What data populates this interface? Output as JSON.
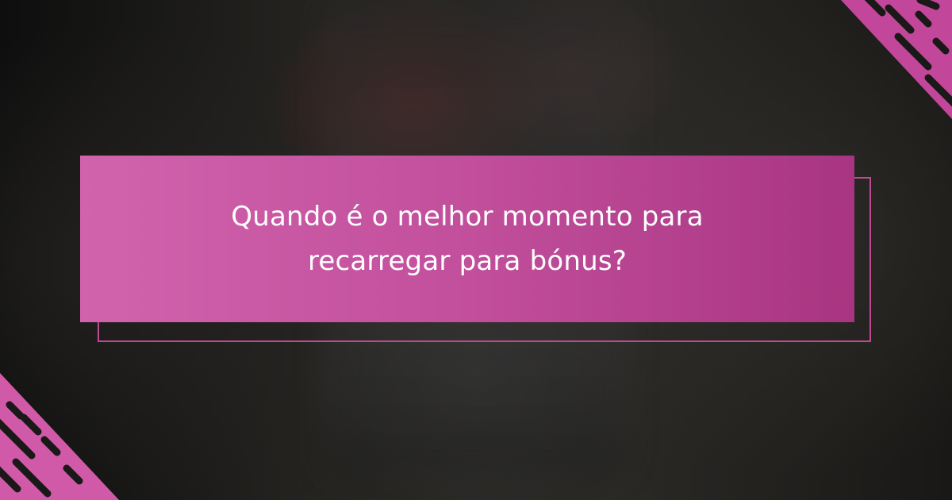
{
  "headline": "Quando é o melhor momento para recarregar para bónus?",
  "colors": {
    "accent": "#c24f9c",
    "accent_light": "#d163ad",
    "accent_dark": "#a83581",
    "text": "#ffffff",
    "background": "#1c1b19"
  },
  "decorations": {
    "top_right": "diagonal-stripes-icon",
    "bottom_left": "diagonal-stripes-icon"
  }
}
